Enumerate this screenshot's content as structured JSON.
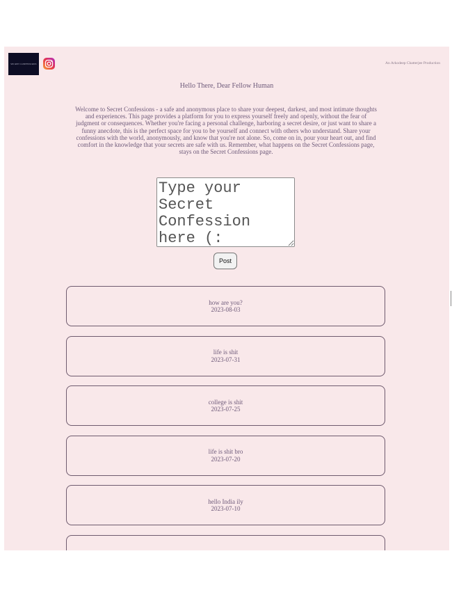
{
  "header": {
    "logo_text": "SECRET CONFESSIONS",
    "credit": "An Arkodeep Chatterjee Production"
  },
  "main": {
    "greeting": "Hello There, Dear Fellow Human",
    "intro": "Welcome to Secret Confessions - a safe and anonymous place to share your deepest, darkest, and most intimate thoughts and experiences. This page provides a platform for you to express yourself freely and openly, without the fear of judgment or consequences. Whether you're facing a personal challenge, harboring a secret desire, or just want to share a funny anecdote, this is the perfect space for you to be yourself and connect with others who understand. Share your confessions with the world, anonymously, and know that you're not alone. So, come on in, pour your heart out, and find comfort in the knowledge that your secrets are safe with us. Remember, what happens on the Secret Confessions page, stays on the Secret Confessions page.",
    "textarea_placeholder": "Type your Secret Confession here (:",
    "textarea_value": "",
    "post_label": "Post"
  },
  "confessions": [
    {
      "text": "how are you?",
      "date": "2023-08-03"
    },
    {
      "text": "life is shit",
      "date": "2023-07-31"
    },
    {
      "text": "college is shit",
      "date": "2023-07-25"
    },
    {
      "text": "life is shit bro",
      "date": "2023-07-20"
    },
    {
      "text": "hello India ily",
      "date": "2023-07-10"
    },
    {
      "text": "",
      "date": ""
    }
  ],
  "colors": {
    "page_background": "#f9e8ea",
    "text": "#6e5a7a",
    "card_border": "#6e5a6e"
  },
  "icons": [
    "instagram-icon"
  ]
}
